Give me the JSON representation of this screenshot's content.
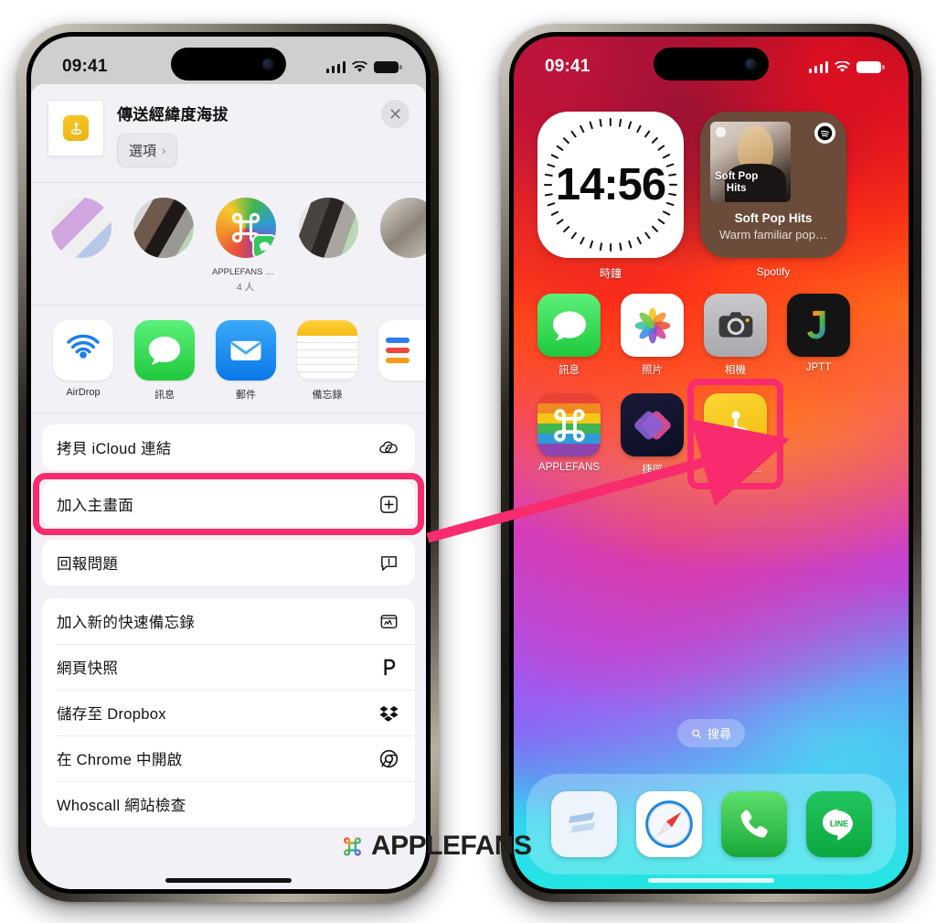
{
  "left_phone": {
    "status": {
      "time": "09:41",
      "signal_icon": "cellular-bars-icon",
      "wifi_icon": "wifi-icon",
      "battery_icon": "battery-icon"
    },
    "share_sheet": {
      "doc_title": "傳送經緯度海拔",
      "doc_icon": "shortcut-location-icon",
      "options_label": "選項",
      "options_chevron": "›",
      "close_icon": "✕",
      "contacts": [
        {
          "name": "",
          "sub": "",
          "type": "blurred"
        },
        {
          "name": "",
          "sub": "",
          "type": "blurred"
        },
        {
          "name": "APPLEFANS 蘋…",
          "sub": "4 人",
          "type": "applefans"
        },
        {
          "name": "",
          "sub": "",
          "type": "blurred"
        },
        {
          "name": "",
          "sub": "",
          "type": "blurred"
        }
      ],
      "apps": [
        {
          "label": "AirDrop",
          "icon": "airdrop-icon"
        },
        {
          "label": "訊息",
          "icon": "messages-icon"
        },
        {
          "label": "郵件",
          "icon": "mail-icon"
        },
        {
          "label": "備忘錄",
          "icon": "notes-icon"
        },
        {
          "label": "",
          "icon": "reminders-icon"
        }
      ],
      "group1": [
        {
          "label": "拷貝 iCloud 連結",
          "icon": "icloud-link-icon",
          "highlighted": false
        }
      ],
      "highlighted_row": {
        "label": "加入主畫面",
        "icon": "plus-square-icon",
        "highlighted": true
      },
      "group2": [
        {
          "label": "回報問題",
          "icon": "report-bubble-icon"
        }
      ],
      "group3": [
        {
          "label": "加入新的快速備忘錄",
          "icon": "quick-note-icon"
        },
        {
          "label": "網頁快照",
          "icon": "pocket-icon"
        },
        {
          "label": "儲存至 Dropbox",
          "icon": "dropbox-icon"
        },
        {
          "label": "在 Chrome 中開啟",
          "icon": "chrome-icon"
        },
        {
          "label": "Whoscall 網站檢查",
          "icon": "whoscall-icon"
        }
      ]
    }
  },
  "right_phone": {
    "status": {
      "time": "09:41",
      "signal_icon": "cellular-bars-icon",
      "wifi_icon": "wifi-icon",
      "battery_icon": "battery-icon"
    },
    "home": {
      "widgets": [
        {
          "label": "時鐘",
          "type": "clock",
          "time": "14:56"
        },
        {
          "label": "Spotify",
          "type": "spotify",
          "art_title": "Soft Pop\nHits",
          "title": "Soft Pop Hits",
          "subtitle": "Warm familiar pop…",
          "logo_icon": "spotify-logo-icon"
        }
      ],
      "row1": [
        {
          "label": "訊息",
          "icon": "messages-icon"
        },
        {
          "label": "照片",
          "icon": "photos-icon"
        },
        {
          "label": "相機",
          "icon": "camera-icon"
        },
        {
          "label": "JPTT",
          "icon": "jptt-icon"
        }
      ],
      "row2": [
        {
          "label": "APPLEFANS",
          "icon": "applefans-icon",
          "highlighted": false
        },
        {
          "label": "捷徑",
          "icon": "shortcuts-icon",
          "highlighted": false
        },
        {
          "label": "傳送經緯度海拔",
          "icon": "shortcut-location-icon",
          "highlighted": true
        }
      ],
      "search": {
        "label": "搜尋",
        "icon": "search-icon"
      },
      "dock": [
        {
          "label": "Shimo",
          "icon": "shimo-icon"
        },
        {
          "label": "Safari",
          "icon": "safari-icon"
        },
        {
          "label": "Phone",
          "icon": "phone-icon"
        },
        {
          "label": "LINE",
          "icon": "line-icon"
        }
      ]
    }
  },
  "annotation": {
    "arrow_color": "#f72b6d",
    "highlight_color": "#f72b6d",
    "arrow_from": "加入主畫面",
    "arrow_to": "傳送經緯度海拔"
  },
  "watermark": {
    "text": "APPLEFANS",
    "icon": "command-logo-icon"
  }
}
